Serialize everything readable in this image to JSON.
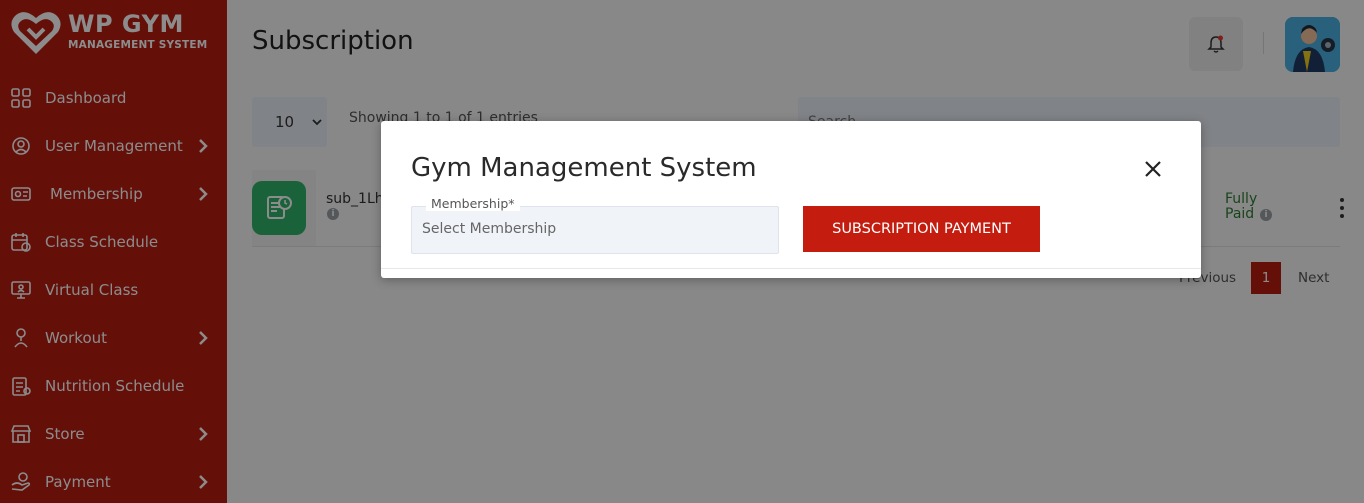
{
  "brand": {
    "title": "WP GYM",
    "subtitle": "MANAGEMENT SYSTEM"
  },
  "sidebar": {
    "items": [
      {
        "label": "Dashboard",
        "icon": "dashboard-icon",
        "has_submenu": false
      },
      {
        "label": "User Management",
        "icon": "user-management-icon",
        "has_submenu": true
      },
      {
        "label": "Membership",
        "icon": "membership-icon",
        "has_submenu": true
      },
      {
        "label": "Class Schedule",
        "icon": "class-schedule-icon",
        "has_submenu": false
      },
      {
        "label": "Virtual Class",
        "icon": "virtual-class-icon",
        "has_submenu": false
      },
      {
        "label": "Workout",
        "icon": "workout-icon",
        "has_submenu": true
      },
      {
        "label": "Nutrition Schedule",
        "icon": "nutrition-icon",
        "has_submenu": false
      },
      {
        "label": "Store",
        "icon": "store-icon",
        "has_submenu": true
      },
      {
        "label": "Payment",
        "icon": "payment-icon",
        "has_submenu": true
      }
    ]
  },
  "header": {
    "title": "Subscription",
    "bell_icon": "bell-icon",
    "avatar_icon": "avatar-icon"
  },
  "table": {
    "page_length": "10",
    "info": "Showing 1 to 1 of 1 entries",
    "search_placeholder": "Search...",
    "rows": [
      {
        "id": "sub_1Lh",
        "status_line1": "Fully",
        "status_line2": "Paid"
      }
    ]
  },
  "pagination": {
    "previous": "Previous",
    "current": "1",
    "next": "Next"
  },
  "modal": {
    "title": "Gym Management System",
    "field_label": "Membership*",
    "field_placeholder": "Select Membership",
    "button_label": "SUBSCRIPTION PAYMENT"
  },
  "colors": {
    "sidebar": "#b81c12",
    "accent": "#c41c0f",
    "row_icon": "#2fb36a",
    "status_paid": "#2e7d32"
  }
}
